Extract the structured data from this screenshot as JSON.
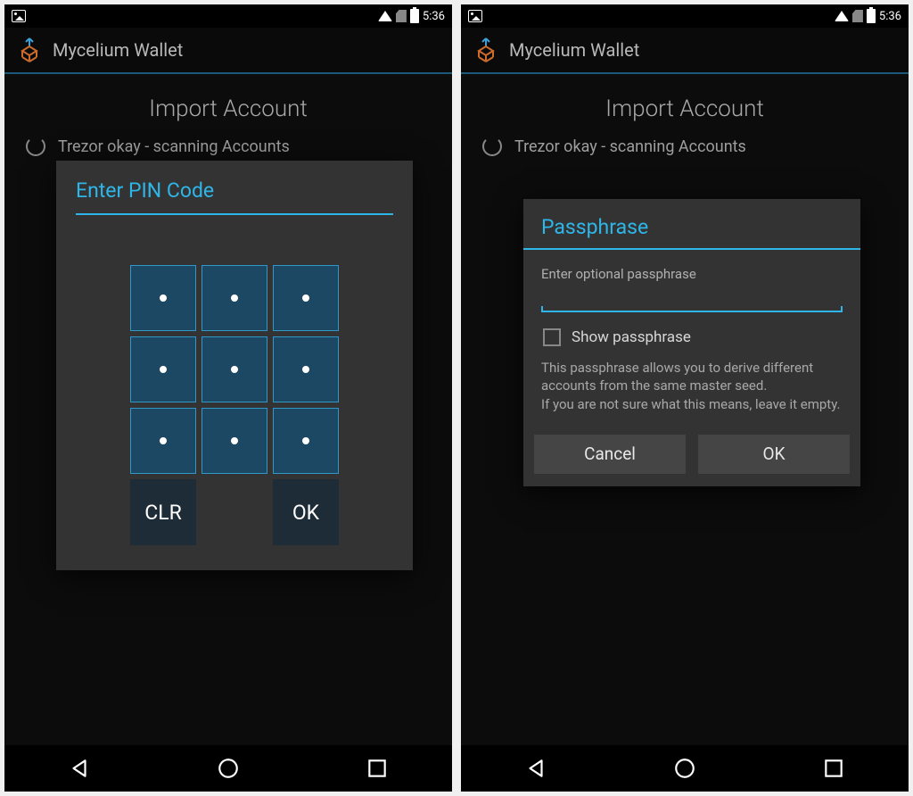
{
  "status": {
    "time": "5:36"
  },
  "app": {
    "title": "Mycelium Wallet"
  },
  "page": {
    "heading": "Import Account",
    "scan_status": "Trezor okay - scanning Accounts"
  },
  "pin_dialog": {
    "title": "Enter PIN Code",
    "clr": "CLR",
    "ok": "OK"
  },
  "pass_dialog": {
    "title": "Passphrase",
    "label": "Enter optional passphrase",
    "show": "Show passphrase",
    "desc": "This passphrase allows you to derive different accounts from the same master seed.\nIf you are not sure what this means, leave it empty.",
    "cancel": "Cancel",
    "ok": "OK"
  }
}
